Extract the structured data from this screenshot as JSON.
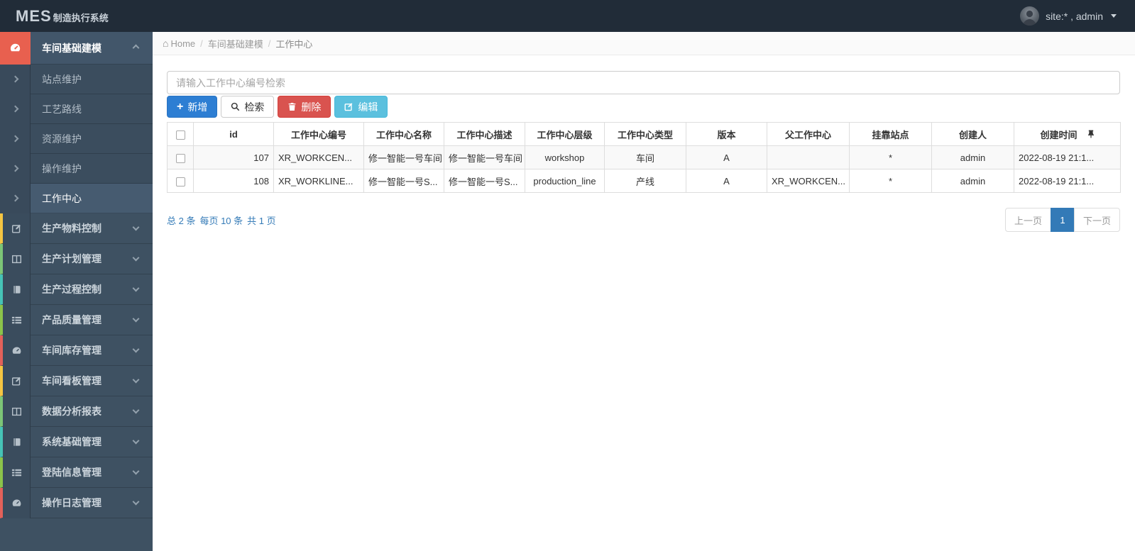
{
  "navbar": {
    "logo_mes": "MES",
    "logo_suffix": "制造执行系统",
    "user_label": "site:* , admin"
  },
  "sidebar": {
    "active_group": {
      "label": "车间基础建模",
      "icon": "dashboard-icon"
    },
    "submenu": [
      {
        "label": "站点维护"
      },
      {
        "label": "工艺路线"
      },
      {
        "label": "资源维护"
      },
      {
        "label": "操作维护"
      },
      {
        "label": "工作中心",
        "active": true
      }
    ],
    "groups": [
      {
        "label": "生产物料控制",
        "icon": "edit-icon",
        "strip": "#f5c542"
      },
      {
        "label": "生产计划管理",
        "icon": "columns-icon",
        "strip": "#7cc576"
      },
      {
        "label": "生产过程控制",
        "icon": "book-icon",
        "strip": "#46c3b6"
      },
      {
        "label": "产品质量管理",
        "icon": "list-icon",
        "strip": "#8bc34a"
      },
      {
        "label": "车间库存管理",
        "icon": "dashboard-icon",
        "strip": "#e3615a"
      },
      {
        "label": "车间看板管理",
        "icon": "edit-icon",
        "strip": "#f5c542"
      },
      {
        "label": "数据分析报表",
        "icon": "columns-icon",
        "strip": "#7cc576"
      },
      {
        "label": "系统基础管理",
        "icon": "book-icon",
        "strip": "#46c3b6"
      },
      {
        "label": "登陆信息管理",
        "icon": "list-icon",
        "strip": "#8bc34a"
      },
      {
        "label": "操作日志管理",
        "icon": "dashboard-icon",
        "strip": "#e3615a"
      }
    ]
  },
  "breadcrumb": {
    "home": "Home",
    "home_icon": "⌂",
    "separator": "/",
    "items": [
      "车间基础建模",
      "工作中心"
    ]
  },
  "toolbar": {
    "search_placeholder": "请输入工作中心编号检索",
    "add_label": "新增",
    "search_label": "检索",
    "delete_label": "删除",
    "edit_label": "编辑"
  },
  "table": {
    "columns": [
      "id",
      "工作中心编号",
      "工作中心名称",
      "工作中心描述",
      "工作中心层级",
      "工作中心类型",
      "版本",
      "父工作中心",
      "挂靠站点",
      "创建人",
      "创建时间"
    ],
    "rows": [
      [
        "107",
        "XR_WORKCEN...",
        "修一智能一号车间",
        "修一智能一号车间",
        "workshop",
        "车间",
        "A",
        "",
        "*",
        "admin",
        "2022-08-19 21:1..."
      ],
      [
        "108",
        "XR_WORKLINE...",
        "修一智能一号S...",
        "修一智能一号S...",
        "production_line",
        "产线",
        "A",
        "XR_WORKCEN...",
        "*",
        "admin",
        "2022-08-19 21:1..."
      ]
    ]
  },
  "pagination": {
    "summary_total": "总 2 条",
    "summary_per_page": "每页 10 条",
    "summary_pages": "共 1 页",
    "prev_label": "上一页",
    "current_page": "1",
    "next_label": "下一页"
  },
  "colors": {
    "navbar_bg": "#212c38",
    "sidebar_bg": "#3e5162",
    "active_accent_red": "#e8604f",
    "primary_blue": "#2d7ed3",
    "danger_red": "#d9534f",
    "info_cyan": "#5bc0de",
    "link_blue": "#337ab7"
  }
}
